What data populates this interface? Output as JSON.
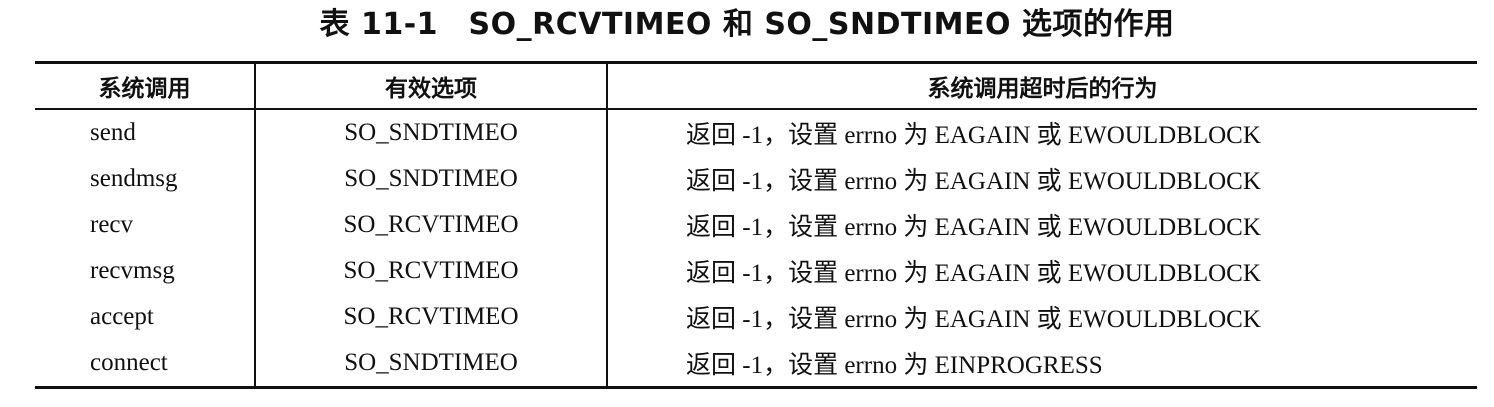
{
  "caption": "表 11-1　SO_RCVTIMEO 和 SO_SNDTIMEO 选项的作用",
  "table": {
    "headers": [
      "系统调用",
      "有效选项",
      "系统调用超时后的行为"
    ],
    "rows": [
      [
        "send",
        "SO_SNDTIMEO",
        "返回 -1，设置 errno 为 EAGAIN 或 EWOULDBLOCK"
      ],
      [
        "sendmsg",
        "SO_SNDTIMEO",
        "返回 -1，设置 errno 为 EAGAIN 或 EWOULDBLOCK"
      ],
      [
        "recv",
        "SO_RCVTIMEO",
        "返回 -1，设置 errno 为 EAGAIN 或 EWOULDBLOCK"
      ],
      [
        "recvmsg",
        "SO_RCVTIMEO",
        "返回 -1，设置 errno 为 EAGAIN 或 EWOULDBLOCK"
      ],
      [
        "accept",
        "SO_RCVTIMEO",
        "返回 -1，设置 errno 为 EAGAIN 或 EWOULDBLOCK"
      ],
      [
        "connect",
        "SO_SNDTIMEO",
        "返回 -1，设置 errno 为 EINPROGRESS"
      ]
    ]
  }
}
